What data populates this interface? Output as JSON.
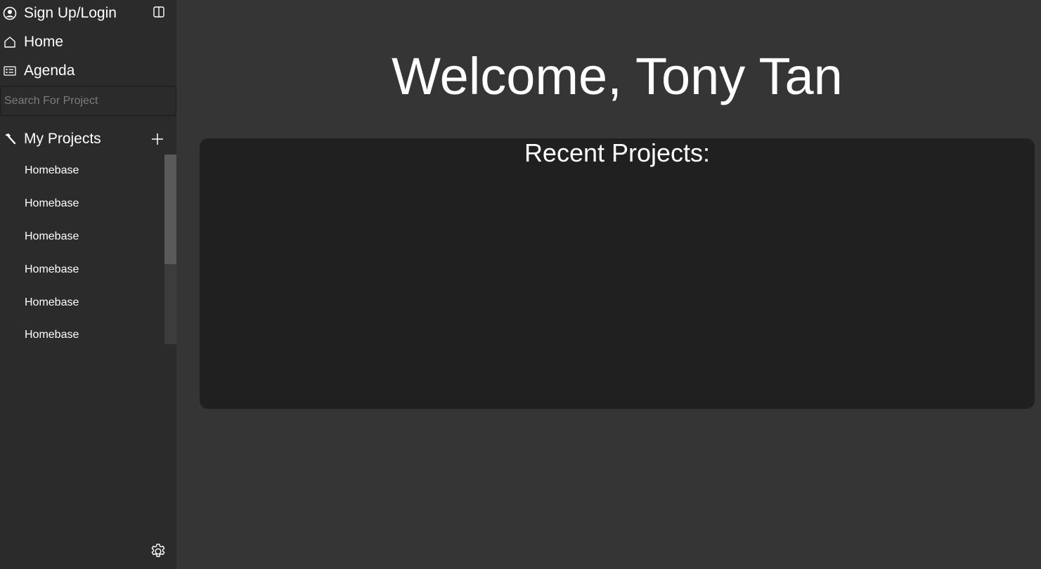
{
  "sidebar": {
    "signup_label": "Sign Up/Login",
    "home_label": "Home",
    "agenda_label": "Agenda",
    "search_placeholder": "Search For Project",
    "projects_header": "My Projects",
    "projects": [
      {
        "label": "Homebase"
      },
      {
        "label": "Homebase"
      },
      {
        "label": "Homebase"
      },
      {
        "label": "Homebase"
      },
      {
        "label": "Homebase"
      },
      {
        "label": "Homebase"
      }
    ],
    "icons": {
      "signup": "user-circle-icon",
      "collapse": "sidebar-toggle-icon",
      "home": "home-icon",
      "agenda": "agenda-list-icon",
      "projects": "hammer-icon",
      "add": "plus-icon",
      "settings": "gear-icon"
    }
  },
  "main": {
    "welcome_text": "Welcome, Tony Tan",
    "recent_title": "Recent Projects:"
  },
  "colors": {
    "background": "#353535",
    "sidebar": "#2b2b2b",
    "panel": "#202020",
    "text": "#ffffff"
  }
}
